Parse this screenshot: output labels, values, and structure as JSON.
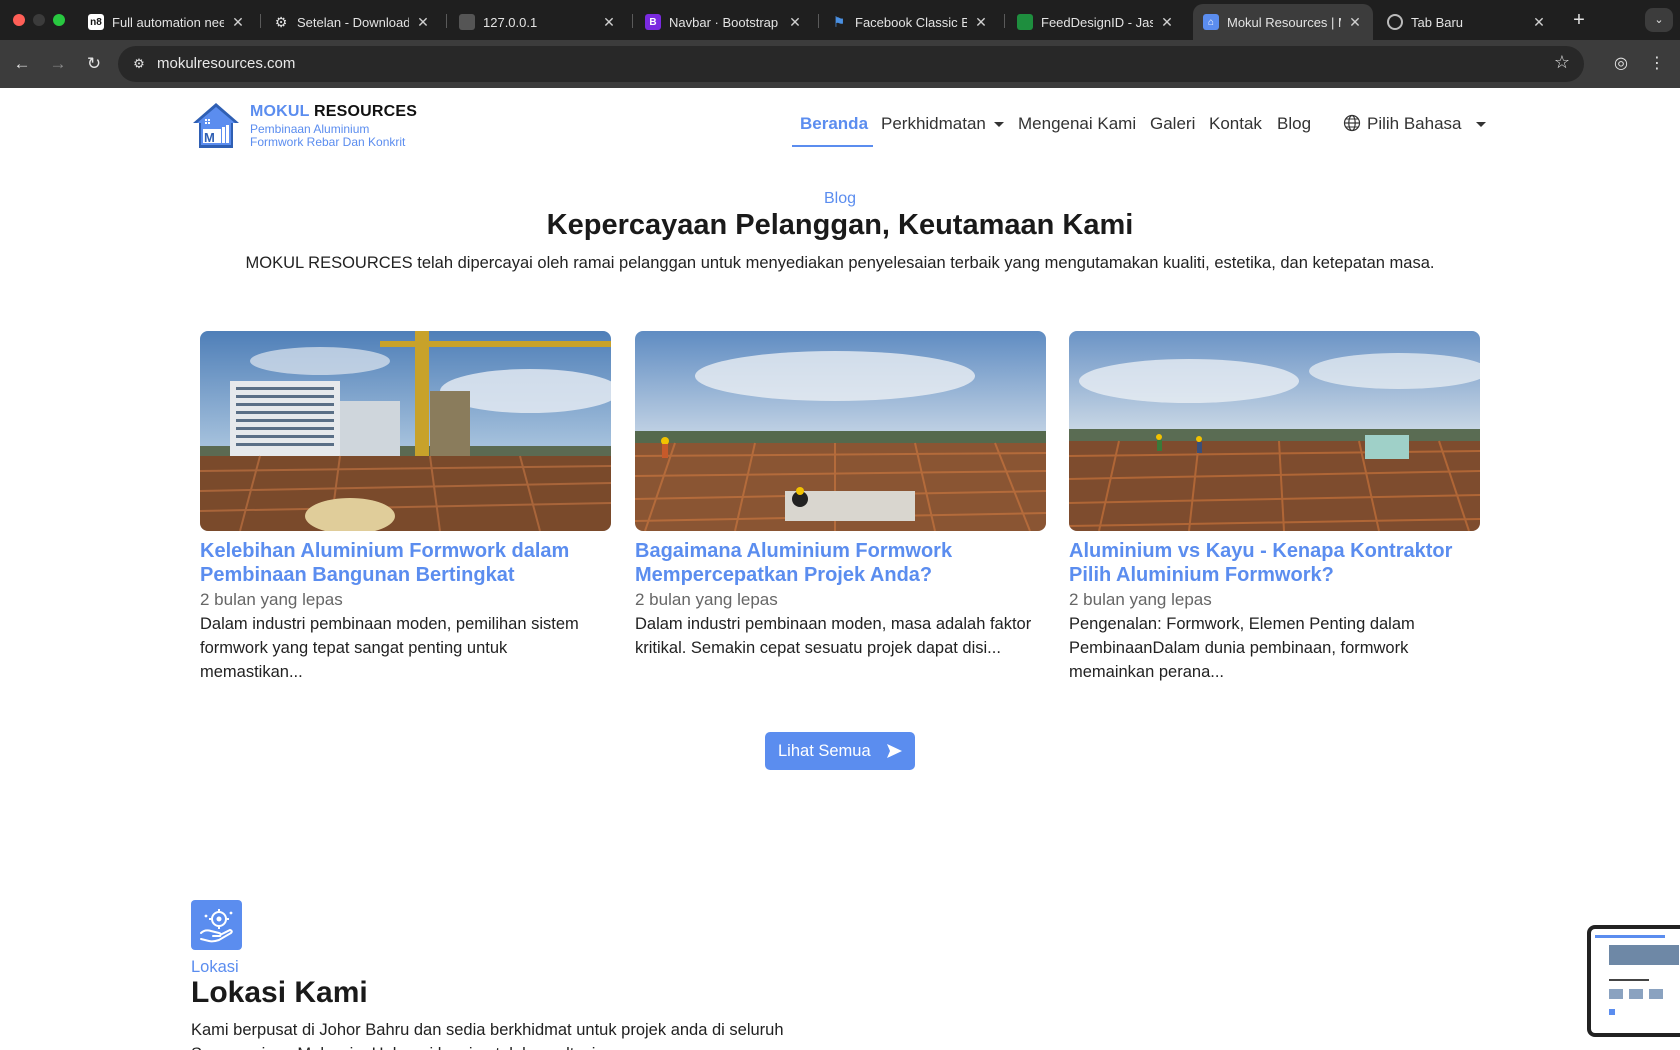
{
  "browser": {
    "tabs": [
      {
        "title": "Full automation nee",
        "favicon": "n8n-icon",
        "active": false
      },
      {
        "title": "Setelan - Download",
        "favicon": "gear-icon",
        "active": false
      },
      {
        "title": "127.0.0.1",
        "favicon": "doc-icon",
        "active": false
      },
      {
        "title": "Navbar · Bootstrap v",
        "favicon": "bootstrap-icon",
        "active": false
      },
      {
        "title": "Facebook Classic Br",
        "favicon": "flag-icon",
        "active": false
      },
      {
        "title": "FeedDesignID - Jasa",
        "favicon": "sheet-icon",
        "active": false
      },
      {
        "title": "Mokul Resources | M",
        "favicon": "mokul-icon",
        "active": true
      },
      {
        "title": "Tab Baru",
        "favicon": "chrome-icon",
        "active": false
      }
    ],
    "url": "mokulresources.com"
  },
  "site": {
    "brand": {
      "name_accent": "MOKUL",
      "name_rest": " RESOURCES",
      "tagline_1": "Pembinaan Aluminium",
      "tagline_2": "Formwork Rebar Dan Konkrit"
    },
    "nav": {
      "home": "Beranda",
      "services": "Perkhidmatan",
      "about": "Mengenai Kami",
      "gallery": "Galeri",
      "contact": "Kontak",
      "blog": "Blog",
      "language": "Pilih Bahasa"
    },
    "blog_section": {
      "eyebrow": "Blog",
      "title": "Kepercayaan Pelanggan, Keutamaan Kami",
      "lead": "MOKUL RESOURCES telah dipercayai oleh ramai pelanggan untuk menyediakan penyelesaian terbaik yang mengutamakan kualiti, estetika, dan ketepatan masa.",
      "posts": [
        {
          "title": "Kelebihan Aluminium Formwork dalam Pembinaan Bangunan Bertingkat",
          "date": "2 bulan yang lepas",
          "excerpt": "Dalam industri pembinaan moden, pemilihan sistem formwork yang tepat sangat penting untuk memastikan..."
        },
        {
          "title": "Bagaimana Aluminium Formwork Mempercepatkan Projek Anda?",
          "date": "2 bulan yang lepas",
          "excerpt": "Dalam industri pembinaan moden, masa adalah faktor kritikal. Semakin cepat sesuatu projek dapat disi..."
        },
        {
          "title": "Aluminium vs Kayu - Kenapa Kontraktor Pilih Aluminium Formwork?",
          "date": "2 bulan yang lepas",
          "excerpt": "Pengenalan: Formwork, Elemen Penting dalam PembinaanDalam dunia pembinaan, formwork memainkan perana..."
        }
      ],
      "view_all": "Lihat Semua"
    },
    "location_section": {
      "eyebrow": "Lokasi",
      "title": "Lokasi Kami",
      "text": "Kami berpusat di Johor Bahru dan sedia berkhidmat untuk projek anda di seluruh Semenanjung Malaysia. Hubungi kami untuk konsultasi percuma."
    }
  },
  "colors": {
    "accent": "#5b8def",
    "chrome_dark": "#1f1f1f",
    "chrome_toolbar": "#3c3c3c"
  }
}
